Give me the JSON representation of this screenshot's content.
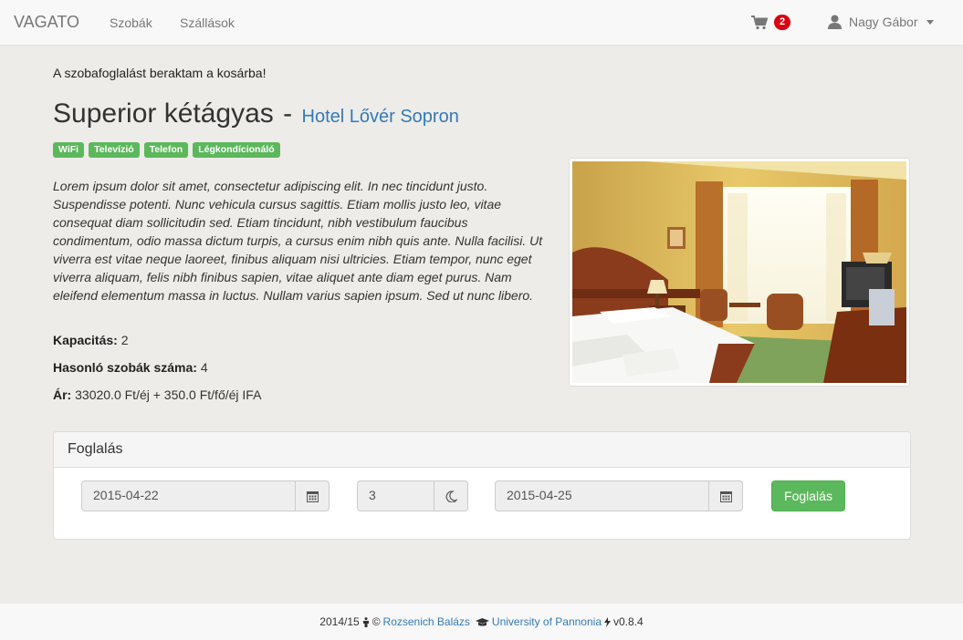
{
  "nav": {
    "brand": "VAGATO",
    "links": [
      "Szobák",
      "Szállások"
    ],
    "cart_count": "2",
    "user_name": "Nagy Gábor"
  },
  "alert": "A szobafoglalást beraktam a kosárba!",
  "room": {
    "name": "Superior kétágyas",
    "separator": "-",
    "hotel": "Hotel Lővér Sopron",
    "tags": [
      "WiFi",
      "Televízió",
      "Telefon",
      "Légkondícionáló"
    ],
    "description": "Lorem ipsum dolor sit amet, consectetur adipiscing elit. In nec tincidunt justo. Suspendisse potenti. Nunc vehicula cursus sagittis. Etiam mollis justo leo, vitae consequat diam sollicitudin sed. Etiam tincidunt, nibh vestibulum faucibus condimentum, odio massa dictum turpis, a cursus enim nibh quis ante. Nulla facilisi. Ut viverra est vitae neque laoreet, finibus aliquam nisi ultricies. Etiam tempor, nunc eget viverra aliquam, felis nibh finibus sapien, vitae aliquet ante diam eget purus. Nam eleifend elementum massa in luctus. Nullam varius sapien ipsum. Sed ut nunc libero.",
    "capacity_label": "Kapacitás:",
    "capacity_value": "2",
    "similar_label": "Hasonló szobák száma:",
    "similar_value": "4",
    "price_label": "Ár:",
    "price_value": "33020.0 Ft/éj + 350.0 Ft/fő/éj IFA"
  },
  "booking": {
    "heading": "Foglalás",
    "start_date": "2015-04-22",
    "nights": "3",
    "end_date": "2015-04-25",
    "button": "Foglalás"
  },
  "footer": {
    "year": "2014/15",
    "copyright": "©",
    "author": "Rozsenich Balázs",
    "university": "University of Pannonia",
    "version": "v0.8.4"
  },
  "colors": {
    "success": "#5cb85c",
    "link": "#337ab7",
    "badge": "#d9000f"
  },
  "icons": [
    "shopping-cart-icon",
    "user-icon",
    "calendar-icon",
    "moon-icon",
    "graduation-cap-icon",
    "man-icon",
    "bolt-icon"
  ]
}
